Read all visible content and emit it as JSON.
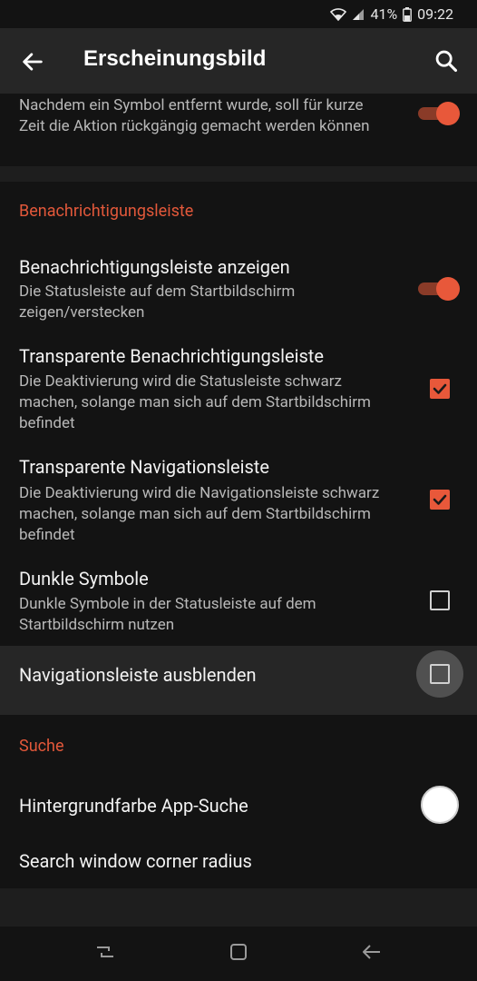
{
  "status_bar": {
    "battery": "41%",
    "time": "09:22"
  },
  "app_bar": {
    "title": "Erscheinungsbild"
  },
  "top_row": {
    "subtitle": "Nachdem ein Symbol entfernt wurde, soll für kurze Zeit die Aktion rückgängig gemacht werden können",
    "toggle_on": true
  },
  "sections": {
    "notification": {
      "header": "Benachrichtigungsleiste",
      "items": [
        {
          "title": "Benachrichtigungsleiste anzeigen",
          "subtitle": "Die Statusleiste auf dem Startbildschirm zeigen/verstecken",
          "control": "switch",
          "checked": true
        },
        {
          "title": "Transparente Benachrichtigungsleiste",
          "subtitle": "Die Deaktivierung wird die Statusleiste schwarz machen, solange man sich auf dem Startbildschirm befindet",
          "control": "checkbox",
          "checked": true
        },
        {
          "title": "Transparente Navigationsleiste",
          "subtitle": "Die Deaktivierung wird die Navigationsleiste schwarz machen, solange man sich auf dem Startbildschirm befindet",
          "control": "checkbox",
          "checked": true
        },
        {
          "title": "Dunkle Symbole",
          "subtitle": "Dunkle Symbole in der Statusleiste auf dem Startbildschirm nutzen",
          "control": "checkbox",
          "checked": false
        },
        {
          "title": "Navigationsleiste ausblenden",
          "control": "checkbox",
          "checked": false
        }
      ]
    },
    "search": {
      "header": "Suche",
      "items": [
        {
          "title": "Hintergrundfarbe App-Suche",
          "control": "color",
          "color": "#ffffff"
        },
        {
          "title": "Search window corner radius"
        }
      ]
    }
  },
  "colors": {
    "accent": "#e8583a",
    "background": "#131313",
    "app_bar": "#262626"
  }
}
